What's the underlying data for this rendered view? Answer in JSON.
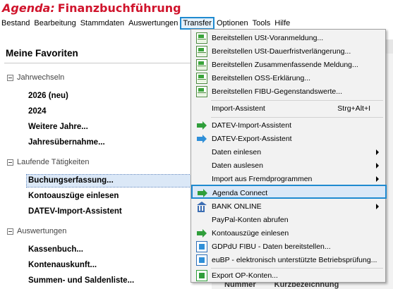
{
  "app": {
    "brand": "Agenda:",
    "title": "Finanzbuchführung"
  },
  "menubar": {
    "items": [
      "Bestand",
      "Bearbeitung",
      "Stammdaten",
      "Auswertungen",
      "Transfer",
      "Optionen",
      "Tools",
      "Hilfe"
    ],
    "active": "Transfer"
  },
  "favorites": {
    "title": "Meine Favoriten",
    "sections": [
      {
        "label": "Jahrwechseln",
        "items": [
          "2026 (neu)",
          "2024",
          "Weitere Jahre...",
          "Jahresübernahme..."
        ]
      },
      {
        "label": "Laufende Tätigkeiten",
        "items": [
          "Buchungserfassung...",
          "Kontoauszüge einlesen",
          "DATEV-Import-Assistent"
        ]
      },
      {
        "label": "Auswertungen",
        "items": [
          "Kassenbuch...",
          "Kontenauskunft...",
          "Summen- und Saldenliste..."
        ]
      }
    ],
    "selected_item": "Buchungserfassung..."
  },
  "background_table": {
    "headers": [
      "Nummer",
      "Kurzbezeichnung"
    ]
  },
  "transfer_menu": {
    "items": [
      {
        "label": "Bereitstellen USt-Voranmeldung...",
        "icon": "document-ust-icon",
        "icon_text": "ZSU"
      },
      {
        "label": "Bereitstellen USt-Dauerfristverlängerung...",
        "icon": "document-ust-icon",
        "icon_text": "ZDA"
      },
      {
        "label": "Bereitstellen Zusammenfassende Meldung...",
        "icon": "document-zm-icon",
        "icon_text": "ZM"
      },
      {
        "label": "Bereitstellen OSS-Erklärung...",
        "icon": "document-oss-icon",
        "icon_text": "OSS"
      },
      {
        "label": "Bereitstellen FIBU-Gegenstandswerte...",
        "icon": "document-fibu-icon",
        "icon_text": "FIBU"
      },
      {
        "label": "Import-Assistent",
        "shortcut": "Strg+Alt+I"
      },
      {
        "label": "DATEV-Import-Assistent",
        "icon": "import-arrow-icon"
      },
      {
        "label": "DATEV-Export-Assistent",
        "icon": "export-arrow-icon"
      },
      {
        "label": "Daten einlesen",
        "submenu": true
      },
      {
        "label": "Daten auslesen",
        "submenu": true
      },
      {
        "label": "Import aus Fremdprogrammen",
        "submenu": true
      },
      {
        "label": "Agenda Connect",
        "icon": "connect-arrow-icon",
        "highlighted": true
      },
      {
        "label": "BANK ONLINE",
        "icon": "bank-icon",
        "submenu": true
      },
      {
        "label": "PayPal-Konten abrufen"
      },
      {
        "label": "Kontoauszüge einlesen",
        "icon": "statement-arrow-icon"
      },
      {
        "label": "GDPdU FIBU - Daten bereitstellen...",
        "icon": "gdpdu-icon"
      },
      {
        "label": "euBP - elektronisch unterstützte Betriebsprüfung...",
        "icon": "eubp-icon"
      },
      {
        "label": "Export OP-Konten...",
        "icon": "export-op-icon"
      }
    ]
  }
}
